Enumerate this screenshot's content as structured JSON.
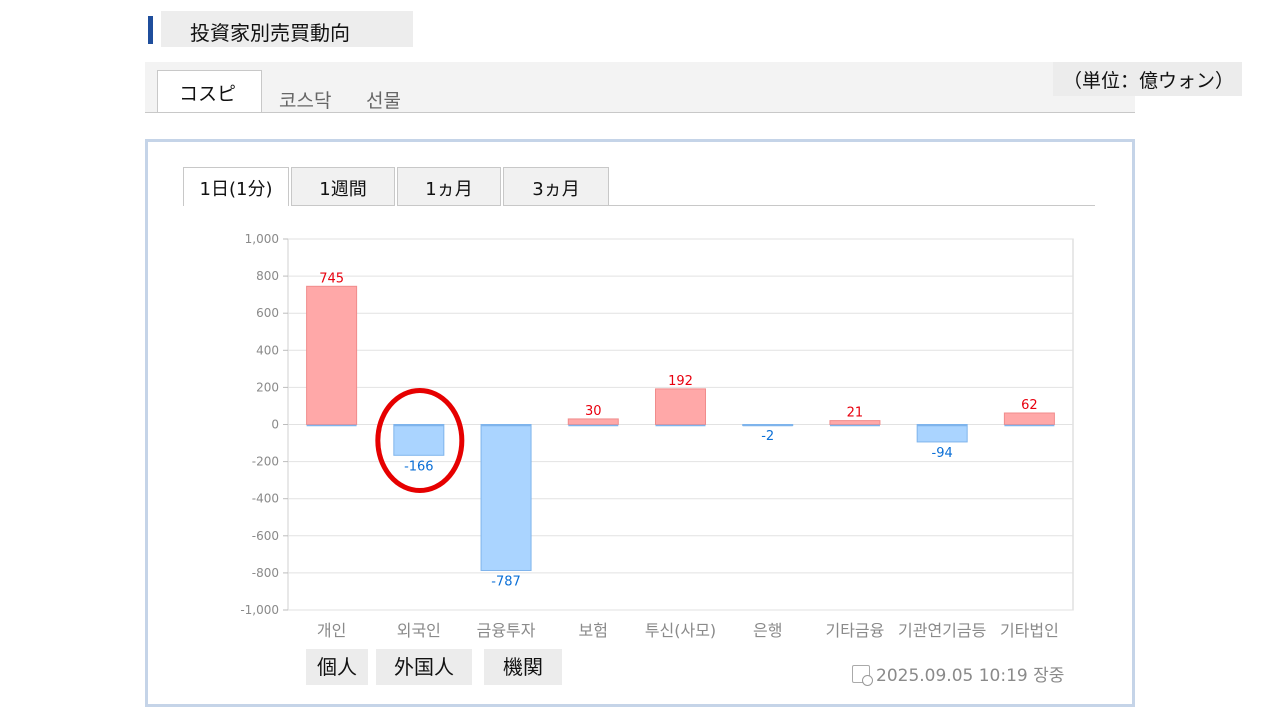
{
  "header": {
    "title": "投資家別売買動向"
  },
  "tabs": {
    "items": [
      "コスピ",
      "코스닥",
      "선물"
    ],
    "active": "コスピ"
  },
  "unit_label": "（単位：億ウォン）",
  "period_tabs": [
    "1日(1分)",
    "1週間",
    "1ヵ月",
    "3ヵ月"
  ],
  "category_labels": [
    "個人",
    "外国人",
    "機関"
  ],
  "timestamp": "2025.09.05 10:19 장중",
  "colors": {
    "positive_bar": "#ffa8a8",
    "negative_bar": "#aad4ff",
    "positive_label": "#e8000e",
    "negative_label": "#0b6fd6",
    "highlight_circle": "#e60000"
  },
  "chart_data": {
    "type": "bar",
    "categories": [
      "개인",
      "외국인",
      "금융투자",
      "보험",
      "투신(사모)",
      "은행",
      "기타금융",
      "기관연기금등",
      "기타법인"
    ],
    "values": [
      745,
      -166,
      -787,
      30,
      192,
      -2,
      21,
      -94,
      62
    ],
    "ylim": [
      -1000,
      1000
    ],
    "yticks": [
      "1,000",
      "800",
      "600",
      "400",
      "200",
      "0",
      "-200",
      "-400",
      "-600",
      "-800",
      "-1,000"
    ],
    "grid": true,
    "highlight": "외국인"
  }
}
